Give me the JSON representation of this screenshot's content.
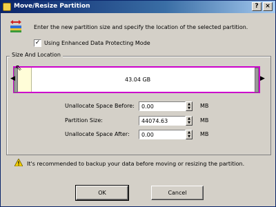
{
  "window": {
    "title": "Move/Resize Partition",
    "help_glyph": "?",
    "close_glyph": "×"
  },
  "intro_text": "Enter the new partition size and specify the location of the selected partition.",
  "enhanced_mode": {
    "label": "Using Enhanced Data Protecting Mode",
    "checked": true,
    "mark": "✓"
  },
  "size_location": {
    "group_label": "Size And Location",
    "bar_size_text": "43.04 GB",
    "fields": [
      {
        "label": "Unallocate Space Before:",
        "value": "0.00",
        "unit": "MB"
      },
      {
        "label": "Partition Size:",
        "value": "44074.63",
        "unit": "MB"
      },
      {
        "label": "Unallocate Space After:",
        "value": "0.00",
        "unit": "MB"
      }
    ]
  },
  "warning_text": "It's recommended to backup your data before moving or resizing the partition.",
  "buttons": {
    "ok": "OK",
    "cancel": "Cancel"
  },
  "colors": {
    "partition_border": "#cc00cc",
    "unallocated_fill": "#fffdd8",
    "title_bar": "#0a246a"
  },
  "icons": {
    "title": "partition-app-icon",
    "header": "move-resize-icon",
    "warning": "warning-icon"
  }
}
